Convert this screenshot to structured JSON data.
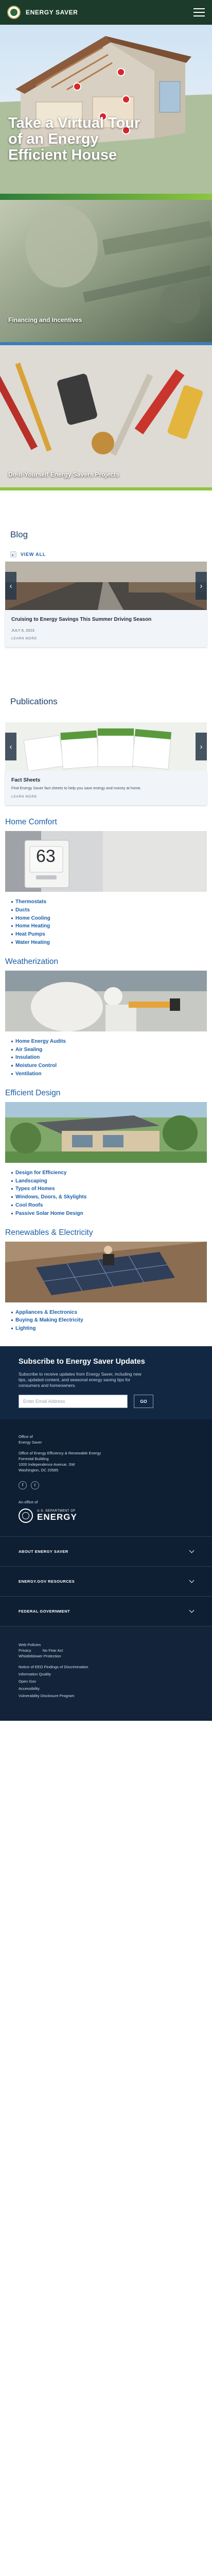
{
  "header": {
    "site_title": "ENERGY SAVER"
  },
  "hero": {
    "title": "Take a Virtual Tour of an Energy Efficient House"
  },
  "tiles": [
    {
      "label": "Financing and Incentives"
    },
    {
      "label": "Do-It-Yourself Energy Savers Projects"
    }
  ],
  "blog": {
    "heading": "Blog",
    "view_all": "VIEW ALL",
    "card": {
      "title": "Cruising to Energy Savings This Summer Driving Season",
      "date": "JULY 6, 2023",
      "link": "LEARN MORE"
    }
  },
  "publications": {
    "heading": "Publications",
    "card": {
      "title": "Fact Sheets",
      "text": "Find Energy Saver fact sheets to help you save energy and money at home.",
      "link": "LEARN MORE"
    }
  },
  "thermostat_display": "63",
  "topics": [
    {
      "heading": "Home Comfort",
      "items": [
        "Thermostats",
        "Ducts",
        "Home Cooling",
        "Home Heating",
        "Heat Pumps",
        "Water Heating"
      ]
    },
    {
      "heading": "Weatherization",
      "items": [
        "Home Energy Audits",
        "Air Sealing",
        "Insulation",
        "Moisture Control",
        "Ventilation"
      ]
    },
    {
      "heading": "Efficient Design",
      "items": [
        "Design for Efficiency",
        "Landscaping",
        "Types of Homes",
        "Windows, Doors, & Skylights",
        "Cool Roofs",
        "Passive Solar Home Design"
      ]
    },
    {
      "heading": "Renewables & Electricity",
      "items": [
        "Appliances & Electronics",
        "Buying & Making Electricity",
        "Lighting"
      ]
    }
  ],
  "subscribe": {
    "title": "Subscribe to Energy Saver Updates",
    "text": "Subscribe to receive updates from Energy Saver, including new tips, updated content, and seasonal energy saving tips for consumers and homeowners.",
    "placeholder": "Enter Email Address",
    "button": "GO"
  },
  "footer": {
    "office_lines": [
      "Office of",
      "Energy Saver"
    ],
    "eere_lines": [
      "Office of Energy Efficiency & Renewable Energy"
    ],
    "address_lines": [
      "Forrestal Building",
      "1000 Independence Avenue, SW",
      "Washington, DC 20585"
    ],
    "social": [
      {
        "icon": "facebook-icon",
        "glyph": "f"
      },
      {
        "icon": "twitter-icon",
        "glyph": "t"
      }
    ],
    "an_office_of": "An office of",
    "doe_small": "U.S. DEPARTMENT OF",
    "doe_big": "ENERGY",
    "accordion": [
      "ABOUT ENERGY SAVER",
      "ENERGY.GOV RESOURCES",
      "FEDERAL GOVERNMENT"
    ],
    "links_row": [
      "Web Policies",
      "Privacy",
      "No Fear Act",
      "Whistleblower Protection"
    ],
    "links_col": [
      "Notice of EEO Findings of Discrimination",
      "Information Quality",
      "Open Gov",
      "Accessibility",
      "Vulnerability Disclosure Program"
    ]
  }
}
